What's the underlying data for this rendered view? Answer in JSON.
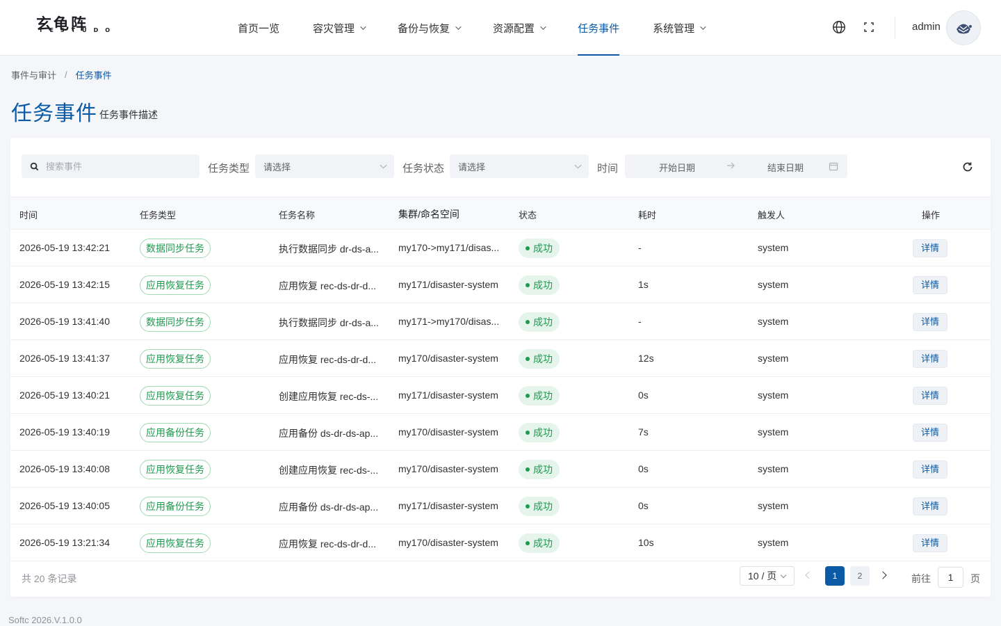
{
  "brand": {
    "name_cn": "玄龟阵",
    "name_en": "TESTUDO"
  },
  "nav": {
    "items": [
      {
        "label": "首页一览",
        "dropdown": false
      },
      {
        "label": "容灾管理",
        "dropdown": true
      },
      {
        "label": "备份与恢复",
        "dropdown": true
      },
      {
        "label": "资源配置",
        "dropdown": true
      },
      {
        "label": "任务事件",
        "dropdown": false,
        "active": true
      },
      {
        "label": "系统管理",
        "dropdown": true
      }
    ]
  },
  "user": {
    "name": "admin"
  },
  "breadcrumb": {
    "parent": "事件与审计",
    "separator": "/",
    "current": "任务事件"
  },
  "page": {
    "title": "任务事件",
    "description": "任务事件描述"
  },
  "filters": {
    "search_placeholder": "搜索事件",
    "type_label": "任务类型",
    "type_placeholder": "请选择",
    "status_label": "任务状态",
    "status_placeholder": "请选择",
    "time_label": "时间",
    "start_placeholder": "开始日期",
    "end_placeholder": "结束日期",
    "range_arrow": "→"
  },
  "table": {
    "columns": [
      "时间",
      "任务类型",
      "任务名称",
      "集群/命名空间",
      "状态",
      "耗时",
      "触发人",
      "操作"
    ],
    "rows": [
      {
        "time": "2026-05-19 13:42:21",
        "type": "数据同步任务",
        "name": "执行数据同步 dr-ds-a...",
        "cluster": "my170->my171/disas...",
        "status": "成功",
        "duration": "-",
        "trigger": "system",
        "action": "详情"
      },
      {
        "time": "2026-05-19 13:42:15",
        "type": "应用恢复任务",
        "name": "应用恢复 rec-ds-dr-d...",
        "cluster": "my171/disaster-system",
        "status": "成功",
        "duration": "1s",
        "trigger": "system",
        "action": "详情"
      },
      {
        "time": "2026-05-19 13:41:40",
        "type": "数据同步任务",
        "name": "执行数据同步 dr-ds-a...",
        "cluster": "my171->my170/disas...",
        "status": "成功",
        "duration": "-",
        "trigger": "system",
        "action": "详情"
      },
      {
        "time": "2026-05-19 13:41:37",
        "type": "应用恢复任务",
        "name": "应用恢复 rec-ds-dr-d...",
        "cluster": "my170/disaster-system",
        "status": "成功",
        "duration": "12s",
        "trigger": "system",
        "action": "详情"
      },
      {
        "time": "2026-05-19 13:40:21",
        "type": "应用恢复任务",
        "name": "创建应用恢复 rec-ds-...",
        "cluster": "my171/disaster-system",
        "status": "成功",
        "duration": "0s",
        "trigger": "system",
        "action": "详情"
      },
      {
        "time": "2026-05-19 13:40:19",
        "type": "应用备份任务",
        "name": "应用备份 ds-dr-ds-ap...",
        "cluster": "my170/disaster-system",
        "status": "成功",
        "duration": "7s",
        "trigger": "system",
        "action": "详情"
      },
      {
        "time": "2026-05-19 13:40:08",
        "type": "应用恢复任务",
        "name": "创建应用恢复 rec-ds-...",
        "cluster": "my170/disaster-system",
        "status": "成功",
        "duration": "0s",
        "trigger": "system",
        "action": "详情"
      },
      {
        "time": "2026-05-19 13:40:05",
        "type": "应用备份任务",
        "name": "应用备份 ds-dr-ds-ap...",
        "cluster": "my171/disaster-system",
        "status": "成功",
        "duration": "0s",
        "trigger": "system",
        "action": "详情"
      },
      {
        "time": "2026-05-19 13:21:34",
        "type": "应用恢复任务",
        "name": "应用恢复 rec-ds-dr-d...",
        "cluster": "my170/disaster-system",
        "status": "成功",
        "duration": "10s",
        "trigger": "system",
        "action": "详情"
      }
    ]
  },
  "pagination": {
    "total_text": "共 20 条记录",
    "page_size": "10 / 页",
    "pages": [
      "1",
      "2"
    ],
    "current_page": "1",
    "goto_label": "前往",
    "goto_value": "1",
    "goto_suffix": "页"
  },
  "footer": {
    "version": "Softc 2026.V.1.0.0"
  },
  "colors": {
    "primary": "#0b5aa6",
    "success": "#1f9a4f",
    "success_bg": "#e5f5ec"
  },
  "icons": [
    "globe-icon",
    "fullscreen-icon",
    "avatar-icon",
    "search-icon",
    "chevron-down-icon",
    "arrow-right-icon",
    "calendar-icon",
    "refresh-icon",
    "chevron-left-icon",
    "chevron-right-icon"
  ]
}
